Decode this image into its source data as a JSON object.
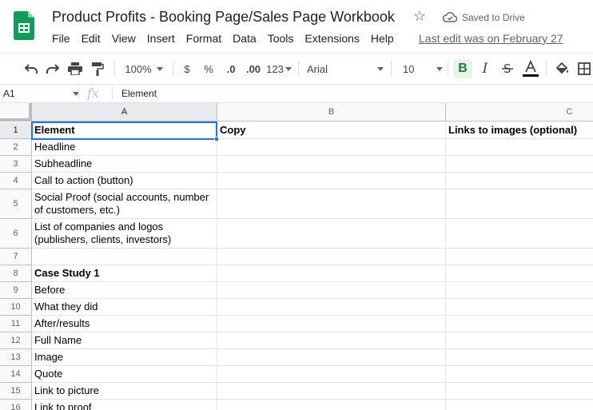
{
  "app": {
    "doc_title": "Product Profits - Booking Page/Sales Page Workbook",
    "save_status": "Saved to Drive",
    "last_edit": "Last edit was on February 27",
    "menu": [
      "File",
      "Edit",
      "View",
      "Insert",
      "Format",
      "Data",
      "Tools",
      "Extensions",
      "Help"
    ]
  },
  "toolbar": {
    "zoom": "100%",
    "currency": "$",
    "percent": "%",
    "decrease_decimal": ".0",
    "increase_decimal": ".00",
    "more_formats": "123",
    "font": "Arial",
    "font_size": "10",
    "bold_active": true
  },
  "formula_bar": {
    "cell_ref": "A1",
    "fx": "fx",
    "value": "Element"
  },
  "grid": {
    "columns": [
      "A",
      "B",
      "C"
    ],
    "selected_cell": "A1",
    "rows": [
      {
        "n": "1",
        "a": "Element",
        "b": "Copy",
        "c": "Links to images (optional)",
        "bold": true
      },
      {
        "n": "2",
        "a": "Headline",
        "b": "",
        "c": ""
      },
      {
        "n": "3",
        "a": "Subheadline",
        "b": "",
        "c": ""
      },
      {
        "n": "4",
        "a": "Call to action (button)",
        "b": "",
        "c": ""
      },
      {
        "n": "5",
        "a": "Social Proof (social accounts, number of customers, etc.)",
        "b": "",
        "c": ""
      },
      {
        "n": "6",
        "a": "List of companies and logos (publishers, clients, investors)",
        "b": "",
        "c": ""
      },
      {
        "n": "7",
        "a": "",
        "b": "",
        "c": ""
      },
      {
        "n": "8",
        "a": "Case Study 1",
        "b": "",
        "c": "",
        "bold": true
      },
      {
        "n": "9",
        "a": "Before",
        "b": "",
        "c": ""
      },
      {
        "n": "10",
        "a": "What they did",
        "b": "",
        "c": ""
      },
      {
        "n": "11",
        "a": "After/results",
        "b": "",
        "c": ""
      },
      {
        "n": "12",
        "a": "Full Name",
        "b": "",
        "c": ""
      },
      {
        "n": "13",
        "a": "Image",
        "b": "",
        "c": ""
      },
      {
        "n": "14",
        "a": "Quote",
        "b": "",
        "c": ""
      },
      {
        "n": "15",
        "a": "Link to picture",
        "b": "",
        "c": ""
      },
      {
        "n": "16",
        "a": "Link to proof",
        "b": "",
        "c": ""
      }
    ]
  },
  "colors": {
    "accent": "#1a73e8",
    "sheets_green": "#0f9d58",
    "bold_active_bg": "#e6f4ea"
  },
  "icons": [
    "sheets-logo-icon",
    "star-icon",
    "cloud-done-icon",
    "undo-icon",
    "redo-icon",
    "print-icon",
    "paint-format-icon",
    "strikethrough-icon",
    "text-color-icon",
    "fill-color-icon",
    "borders-icon"
  ]
}
